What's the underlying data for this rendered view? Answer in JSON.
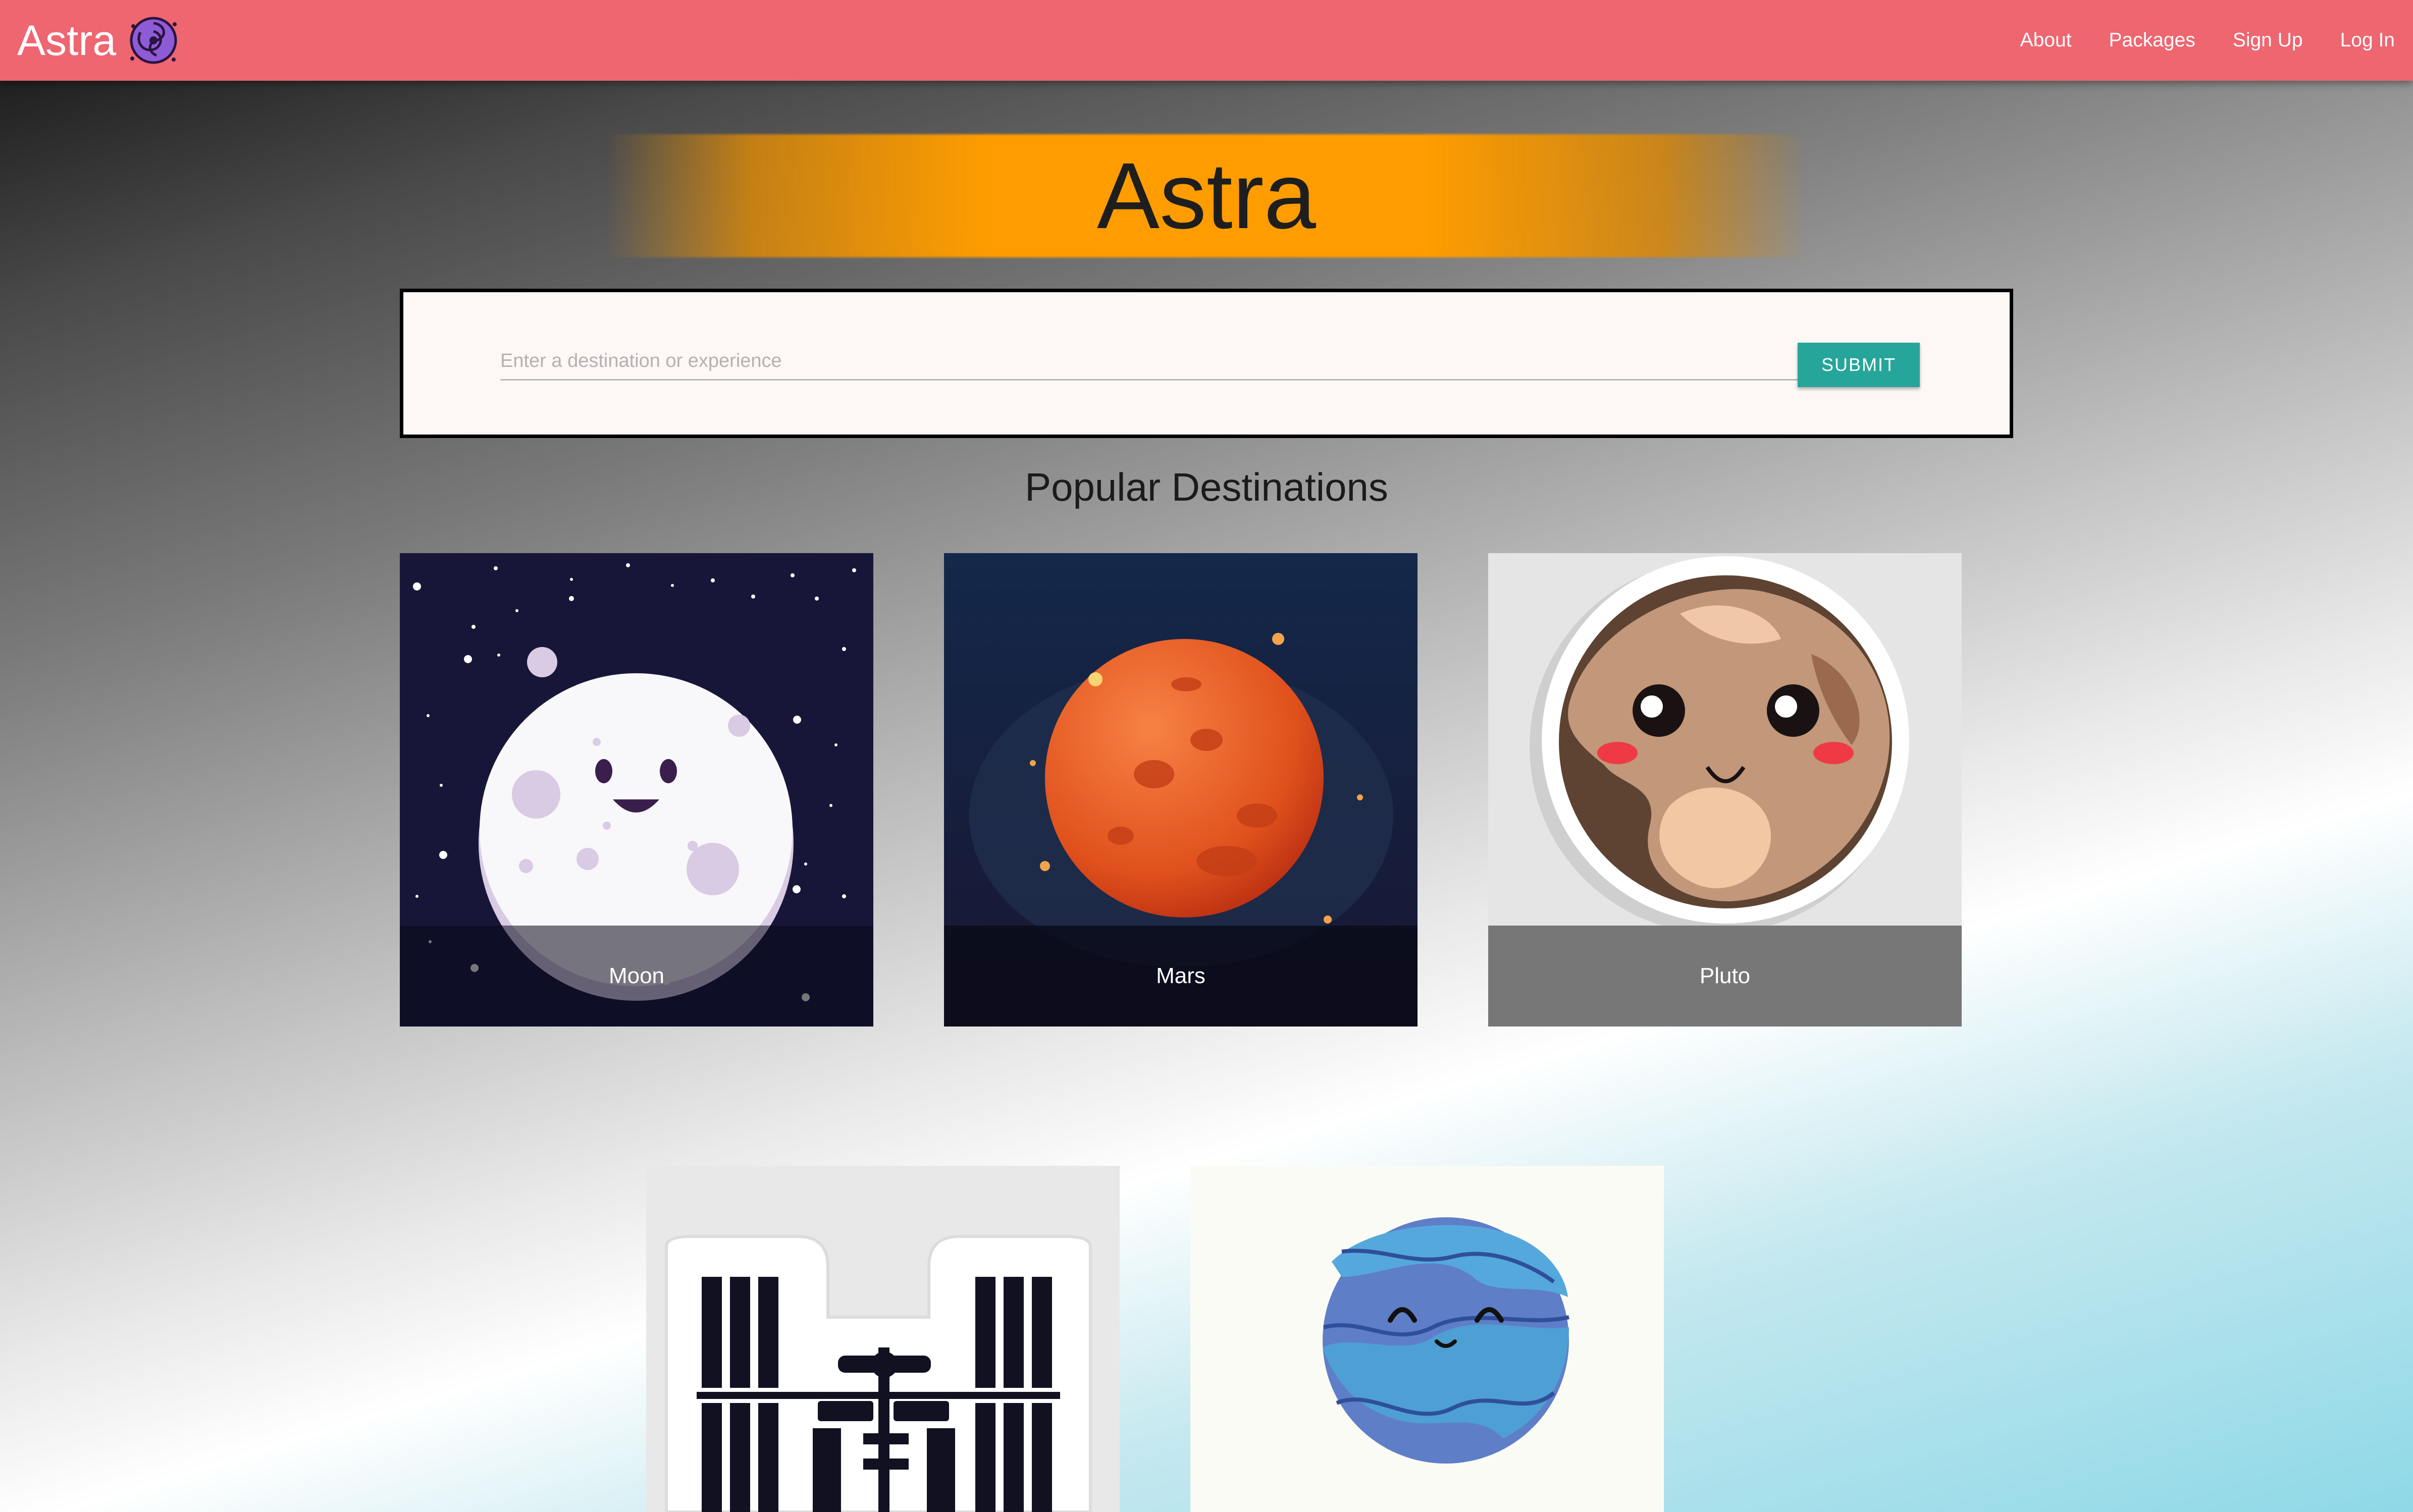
{
  "navbar": {
    "brand": "Astra",
    "links": [
      "About",
      "Packages",
      "Sign Up",
      "Log In"
    ]
  },
  "hero": {
    "title": "Astra"
  },
  "search": {
    "placeholder": "Enter a destination or experience",
    "value": "",
    "submit_label": "SUBMIT"
  },
  "destinations": {
    "heading": "Popular Destinations",
    "cards": [
      {
        "name": "Moon",
        "icon": "moon-icon"
      },
      {
        "name": "Mars",
        "icon": "mars-icon"
      },
      {
        "name": "Pluto",
        "icon": "pluto-icon"
      },
      {
        "name": "",
        "icon": "space-station-icon"
      },
      {
        "name": "",
        "icon": "neptune-icon"
      }
    ]
  },
  "colors": {
    "navbar": "#ee6670",
    "hero_band": "#ff9d00",
    "submit": "#26a69a"
  }
}
